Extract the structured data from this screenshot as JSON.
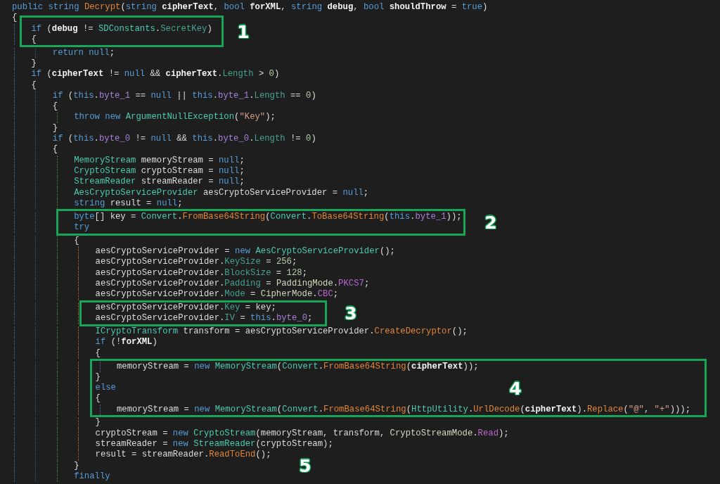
{
  "editor": {
    "lines": [
      {
        "tokens": [
          {
            "text": "public string ",
            "kind": "keyword"
          },
          {
            "text": "Decrypt",
            "kind": "method"
          },
          {
            "text": "(",
            "kind": "plain"
          },
          {
            "text": "string ",
            "kind": "keyword"
          },
          {
            "text": "cipherText",
            "kind": "param"
          },
          {
            "text": ", ",
            "kind": "plain"
          },
          {
            "text": "bool ",
            "kind": "keyword"
          },
          {
            "text": "forXML",
            "kind": "param"
          },
          {
            "text": ", ",
            "kind": "plain"
          },
          {
            "text": "string ",
            "kind": "keyword"
          },
          {
            "text": "debug",
            "kind": "param"
          },
          {
            "text": ", ",
            "kind": "plain"
          },
          {
            "text": "bool ",
            "kind": "keyword"
          },
          {
            "text": "shouldThrow",
            "kind": "param"
          },
          {
            "text": " = ",
            "kind": "plain"
          },
          {
            "text": "true",
            "kind": "keyword"
          },
          {
            "text": ")",
            "kind": "plain"
          }
        ]
      },
      {
        "tokens": [
          {
            "text": "{",
            "kind": "plain"
          }
        ],
        "children": [
          {
            "tokens": [
              {
                "text": "if ",
                "kind": "keyword"
              },
              {
                "text": "(",
                "kind": "plain"
              },
              {
                "text": "debug",
                "kind": "param"
              },
              {
                "text": " != ",
                "kind": "plain"
              },
              {
                "text": "SDConstants",
                "kind": "type"
              },
              {
                "text": ".",
                "kind": "plain"
              },
              {
                "text": "SecretKey",
                "kind": "property"
              },
              {
                "text": ")",
                "kind": "plain"
              }
            ]
          },
          {
            "tokens": [
              {
                "text": "{",
                "kind": "plain"
              }
            ],
            "children": [
              {
                "tokens": [
                  {
                    "text": "return null",
                    "kind": "keyword"
                  },
                  {
                    "text": ";",
                    "kind": "plain"
                  }
                ]
              }
            ]
          },
          {
            "tokens": [
              {
                "text": "}",
                "kind": "plain"
              }
            ]
          },
          {
            "tokens": [
              {
                "text": "if ",
                "kind": "keyword"
              },
              {
                "text": "(",
                "kind": "plain"
              },
              {
                "text": "cipherText",
                "kind": "param"
              },
              {
                "text": " != ",
                "kind": "plain"
              },
              {
                "text": "null",
                "kind": "keyword"
              },
              {
                "text": " && ",
                "kind": "plain"
              },
              {
                "text": "cipherText",
                "kind": "param"
              },
              {
                "text": ".",
                "kind": "plain"
              },
              {
                "text": "Length",
                "kind": "property"
              },
              {
                "text": " > ",
                "kind": "plain"
              },
              {
                "text": "0",
                "kind": "number"
              },
              {
                "text": ")",
                "kind": "plain"
              }
            ]
          },
          {
            "tokens": [
              {
                "text": "{",
                "kind": "plain"
              }
            ],
            "children": [
              {
                "tokens": [
                  {
                    "text": "if ",
                    "kind": "keyword"
                  },
                  {
                    "text": "(",
                    "kind": "plain"
                  },
                  {
                    "text": "this",
                    "kind": "keyword"
                  },
                  {
                    "text": ".",
                    "kind": "plain"
                  },
                  {
                    "text": "byte_1",
                    "kind": "field"
                  },
                  {
                    "text": " == ",
                    "kind": "plain"
                  },
                  {
                    "text": "null",
                    "kind": "keyword"
                  },
                  {
                    "text": " || ",
                    "kind": "plain"
                  },
                  {
                    "text": "this",
                    "kind": "keyword"
                  },
                  {
                    "text": ".",
                    "kind": "plain"
                  },
                  {
                    "text": "byte_1",
                    "kind": "field"
                  },
                  {
                    "text": ".",
                    "kind": "plain"
                  },
                  {
                    "text": "Length",
                    "kind": "property"
                  },
                  {
                    "text": " == ",
                    "kind": "plain"
                  },
                  {
                    "text": "0",
                    "kind": "number"
                  },
                  {
                    "text": ")",
                    "kind": "plain"
                  }
                ]
              },
              {
                "tokens": [
                  {
                    "text": "{",
                    "kind": "plain"
                  }
                ],
                "children": [
                  {
                    "tokens": [
                      {
                        "text": "throw new ",
                        "kind": "keyword"
                      },
                      {
                        "text": "ArgumentNullException",
                        "kind": "type"
                      },
                      {
                        "text": "(",
                        "kind": "plain"
                      },
                      {
                        "text": "\"Key\"",
                        "kind": "string"
                      },
                      {
                        "text": ");",
                        "kind": "plain"
                      }
                    ]
                  }
                ]
              },
              {
                "tokens": [
                  {
                    "text": "}",
                    "kind": "plain"
                  }
                ]
              },
              {
                "tokens": [
                  {
                    "text": "if ",
                    "kind": "keyword"
                  },
                  {
                    "text": "(",
                    "kind": "plain"
                  },
                  {
                    "text": "this",
                    "kind": "keyword"
                  },
                  {
                    "text": ".",
                    "kind": "plain"
                  },
                  {
                    "text": "byte_0",
                    "kind": "field"
                  },
                  {
                    "text": " != ",
                    "kind": "plain"
                  },
                  {
                    "text": "null",
                    "kind": "keyword"
                  },
                  {
                    "text": " && ",
                    "kind": "plain"
                  },
                  {
                    "text": "this",
                    "kind": "keyword"
                  },
                  {
                    "text": ".",
                    "kind": "plain"
                  },
                  {
                    "text": "byte_0",
                    "kind": "field"
                  },
                  {
                    "text": ".",
                    "kind": "plain"
                  },
                  {
                    "text": "Length",
                    "kind": "property"
                  },
                  {
                    "text": " != ",
                    "kind": "plain"
                  },
                  {
                    "text": "0",
                    "kind": "number"
                  },
                  {
                    "text": ")",
                    "kind": "plain"
                  }
                ]
              },
              {
                "tokens": [
                  {
                    "text": "{",
                    "kind": "plain"
                  }
                ],
                "children": [
                  {
                    "tokens": [
                      {
                        "text": "MemoryStream",
                        "kind": "type"
                      },
                      {
                        "text": " memoryStream = ",
                        "kind": "plain"
                      },
                      {
                        "text": "null",
                        "kind": "keyword"
                      },
                      {
                        "text": ";",
                        "kind": "plain"
                      }
                    ]
                  },
                  {
                    "tokens": [
                      {
                        "text": "CryptoStream",
                        "kind": "type"
                      },
                      {
                        "text": " cryptoStream = ",
                        "kind": "plain"
                      },
                      {
                        "text": "null",
                        "kind": "keyword"
                      },
                      {
                        "text": ";",
                        "kind": "plain"
                      }
                    ]
                  },
                  {
                    "tokens": [
                      {
                        "text": "StreamReader",
                        "kind": "type"
                      },
                      {
                        "text": " streamReader = ",
                        "kind": "plain"
                      },
                      {
                        "text": "null",
                        "kind": "keyword"
                      },
                      {
                        "text": ";",
                        "kind": "plain"
                      }
                    ]
                  },
                  {
                    "tokens": [
                      {
                        "text": "AesCryptoServiceProvider",
                        "kind": "type"
                      },
                      {
                        "text": " aesCryptoServiceProvider = ",
                        "kind": "plain"
                      },
                      {
                        "text": "null",
                        "kind": "keyword"
                      },
                      {
                        "text": ";",
                        "kind": "plain"
                      }
                    ]
                  },
                  {
                    "tokens": [
                      {
                        "text": "string",
                        "kind": "keyword"
                      },
                      {
                        "text": " result = ",
                        "kind": "plain"
                      },
                      {
                        "text": "null",
                        "kind": "keyword"
                      },
                      {
                        "text": ";",
                        "kind": "plain"
                      }
                    ]
                  },
                  {
                    "tokens": [
                      {
                        "text": "byte",
                        "kind": "keyword"
                      },
                      {
                        "text": "[] key = ",
                        "kind": "plain"
                      },
                      {
                        "text": "Convert",
                        "kind": "type"
                      },
                      {
                        "text": ".",
                        "kind": "plain"
                      },
                      {
                        "text": "FromBase64String",
                        "kind": "method"
                      },
                      {
                        "text": "(",
                        "kind": "plain"
                      },
                      {
                        "text": "Convert",
                        "kind": "type"
                      },
                      {
                        "text": ".",
                        "kind": "plain"
                      },
                      {
                        "text": "ToBase64String",
                        "kind": "method"
                      },
                      {
                        "text": "(",
                        "kind": "plain"
                      },
                      {
                        "text": "this",
                        "kind": "keyword"
                      },
                      {
                        "text": ".",
                        "kind": "plain"
                      },
                      {
                        "text": "byte_1",
                        "kind": "field"
                      },
                      {
                        "text": "));",
                        "kind": "plain"
                      }
                    ]
                  },
                  {
                    "tokens": [
                      {
                        "text": "try",
                        "kind": "keyword"
                      }
                    ]
                  },
                  {
                    "tokens": [
                      {
                        "text": "{",
                        "kind": "plain"
                      }
                    ],
                    "children": [
                      {
                        "tokens": [
                          {
                            "text": "aesCryptoServiceProvider = ",
                            "kind": "plain"
                          },
                          {
                            "text": "new ",
                            "kind": "keyword"
                          },
                          {
                            "text": "AesCryptoServiceProvider",
                            "kind": "type"
                          },
                          {
                            "text": "();",
                            "kind": "plain"
                          }
                        ]
                      },
                      {
                        "tokens": [
                          {
                            "text": "aesCryptoServiceProvider.",
                            "kind": "plain"
                          },
                          {
                            "text": "KeySize",
                            "kind": "property"
                          },
                          {
                            "text": " = ",
                            "kind": "plain"
                          },
                          {
                            "text": "256",
                            "kind": "number"
                          },
                          {
                            "text": ";",
                            "kind": "plain"
                          }
                        ]
                      },
                      {
                        "tokens": [
                          {
                            "text": "aesCryptoServiceProvider.",
                            "kind": "plain"
                          },
                          {
                            "text": "BlockSize",
                            "kind": "property"
                          },
                          {
                            "text": " = ",
                            "kind": "plain"
                          },
                          {
                            "text": "128",
                            "kind": "number"
                          },
                          {
                            "text": ";",
                            "kind": "plain"
                          }
                        ]
                      },
                      {
                        "tokens": [
                          {
                            "text": "aesCryptoServiceProvider.",
                            "kind": "plain"
                          },
                          {
                            "text": "Padding",
                            "kind": "property"
                          },
                          {
                            "text": " = ",
                            "kind": "plain"
                          },
                          {
                            "text": "PaddingMode",
                            "kind": "enum_type"
                          },
                          {
                            "text": ".",
                            "kind": "plain"
                          },
                          {
                            "text": "PKCS7",
                            "kind": "enum"
                          },
                          {
                            "text": ";",
                            "kind": "plain"
                          }
                        ]
                      },
                      {
                        "tokens": [
                          {
                            "text": "aesCryptoServiceProvider.",
                            "kind": "plain"
                          },
                          {
                            "text": "Mode",
                            "kind": "property"
                          },
                          {
                            "text": " = ",
                            "kind": "plain"
                          },
                          {
                            "text": "CipherMode",
                            "kind": "enum_type"
                          },
                          {
                            "text": ".",
                            "kind": "plain"
                          },
                          {
                            "text": "CBC",
                            "kind": "enum"
                          },
                          {
                            "text": ";",
                            "kind": "plain"
                          }
                        ]
                      },
                      {
                        "tokens": [
                          {
                            "text": "aesCryptoServiceProvider.",
                            "kind": "plain"
                          },
                          {
                            "text": "Key",
                            "kind": "property"
                          },
                          {
                            "text": " = key;",
                            "kind": "plain"
                          }
                        ]
                      },
                      {
                        "tokens": [
                          {
                            "text": "aesCryptoServiceProvider.",
                            "kind": "plain"
                          },
                          {
                            "text": "IV",
                            "kind": "property"
                          },
                          {
                            "text": " = ",
                            "kind": "plain"
                          },
                          {
                            "text": "this",
                            "kind": "keyword"
                          },
                          {
                            "text": ".",
                            "kind": "plain"
                          },
                          {
                            "text": "byte_0",
                            "kind": "field"
                          },
                          {
                            "text": ";",
                            "kind": "plain"
                          }
                        ]
                      },
                      {
                        "tokens": [
                          {
                            "text": "ICryptoTransform",
                            "kind": "type"
                          },
                          {
                            "text": " transform = aesCryptoServiceProvider.",
                            "kind": "plain"
                          },
                          {
                            "text": "CreateDecryptor",
                            "kind": "method"
                          },
                          {
                            "text": "();",
                            "kind": "plain"
                          }
                        ]
                      },
                      {
                        "tokens": [
                          {
                            "text": "if ",
                            "kind": "keyword"
                          },
                          {
                            "text": "(!",
                            "kind": "plain"
                          },
                          {
                            "text": "forXML",
                            "kind": "param"
                          },
                          {
                            "text": ")",
                            "kind": "plain"
                          }
                        ]
                      },
                      {
                        "tokens": [
                          {
                            "text": "{",
                            "kind": "plain"
                          }
                        ],
                        "children": [
                          {
                            "tokens": [
                              {
                                "text": "memoryStream = ",
                                "kind": "plain"
                              },
                              {
                                "text": "new ",
                                "kind": "keyword"
                              },
                              {
                                "text": "MemoryStream",
                                "kind": "type"
                              },
                              {
                                "text": "(",
                                "kind": "plain"
                              },
                              {
                                "text": "Convert",
                                "kind": "type"
                              },
                              {
                                "text": ".",
                                "kind": "plain"
                              },
                              {
                                "text": "FromBase64String",
                                "kind": "method"
                              },
                              {
                                "text": "(",
                                "kind": "plain"
                              },
                              {
                                "text": "cipherText",
                                "kind": "param"
                              },
                              {
                                "text": "));",
                                "kind": "plain"
                              }
                            ]
                          }
                        ]
                      },
                      {
                        "tokens": [
                          {
                            "text": "}",
                            "kind": "plain"
                          }
                        ]
                      },
                      {
                        "tokens": [
                          {
                            "text": "else",
                            "kind": "keyword"
                          }
                        ]
                      },
                      {
                        "tokens": [
                          {
                            "text": "{",
                            "kind": "plain"
                          }
                        ],
                        "children": [
                          {
                            "tokens": [
                              {
                                "text": "memoryStream = ",
                                "kind": "plain"
                              },
                              {
                                "text": "new ",
                                "kind": "keyword"
                              },
                              {
                                "text": "MemoryStream",
                                "kind": "type"
                              },
                              {
                                "text": "(",
                                "kind": "plain"
                              },
                              {
                                "text": "Convert",
                                "kind": "type"
                              },
                              {
                                "text": ".",
                                "kind": "plain"
                              },
                              {
                                "text": "FromBase64String",
                                "kind": "method"
                              },
                              {
                                "text": "(",
                                "kind": "plain"
                              },
                              {
                                "text": "HttpUtility",
                                "kind": "type"
                              },
                              {
                                "text": ".",
                                "kind": "plain"
                              },
                              {
                                "text": "UrlDecode",
                                "kind": "method"
                              },
                              {
                                "text": "(",
                                "kind": "plain"
                              },
                              {
                                "text": "cipherText",
                                "kind": "param"
                              },
                              {
                                "text": ").",
                                "kind": "plain"
                              },
                              {
                                "text": "Replace",
                                "kind": "method"
                              },
                              {
                                "text": "(",
                                "kind": "plain"
                              },
                              {
                                "text": "\"@\"",
                                "kind": "string"
                              },
                              {
                                "text": ", ",
                                "kind": "plain"
                              },
                              {
                                "text": "\"+\"",
                                "kind": "string"
                              },
                              {
                                "text": ")));",
                                "kind": "plain"
                              }
                            ]
                          }
                        ]
                      },
                      {
                        "tokens": [
                          {
                            "text": "}",
                            "kind": "plain"
                          }
                        ]
                      },
                      {
                        "tokens": [
                          {
                            "text": "cryptoStream = ",
                            "kind": "plain"
                          },
                          {
                            "text": "new ",
                            "kind": "keyword"
                          },
                          {
                            "text": "CryptoStream",
                            "kind": "type"
                          },
                          {
                            "text": "(memoryStream, transform, ",
                            "kind": "plain"
                          },
                          {
                            "text": "CryptoStreamMode",
                            "kind": "enum_type"
                          },
                          {
                            "text": ".",
                            "kind": "plain"
                          },
                          {
                            "text": "Read",
                            "kind": "enum"
                          },
                          {
                            "text": ");",
                            "kind": "plain"
                          }
                        ]
                      },
                      {
                        "tokens": [
                          {
                            "text": "streamReader = ",
                            "kind": "plain"
                          },
                          {
                            "text": "new ",
                            "kind": "keyword"
                          },
                          {
                            "text": "StreamReader",
                            "kind": "type"
                          },
                          {
                            "text": "(cryptoStream);",
                            "kind": "plain"
                          }
                        ]
                      },
                      {
                        "tokens": [
                          {
                            "text": "result = streamReader.",
                            "kind": "plain"
                          },
                          {
                            "text": "ReadToEnd",
                            "kind": "method"
                          },
                          {
                            "text": "();",
                            "kind": "plain"
                          }
                        ]
                      }
                    ]
                  },
                  {
                    "tokens": [
                      {
                        "text": "}",
                        "kind": "plain"
                      }
                    ]
                  },
                  {
                    "tokens": [
                      {
                        "text": "finally",
                        "kind": "keyword"
                      }
                    ]
                  }
                ]
              }
            ]
          }
        ]
      }
    ]
  },
  "annotations": [
    {
      "number": "1",
      "boxed": true
    },
    {
      "number": "2",
      "boxed": true
    },
    {
      "number": "3",
      "boxed": true
    },
    {
      "number": "4",
      "boxed": true
    },
    {
      "number": "5",
      "boxed": false
    }
  ]
}
